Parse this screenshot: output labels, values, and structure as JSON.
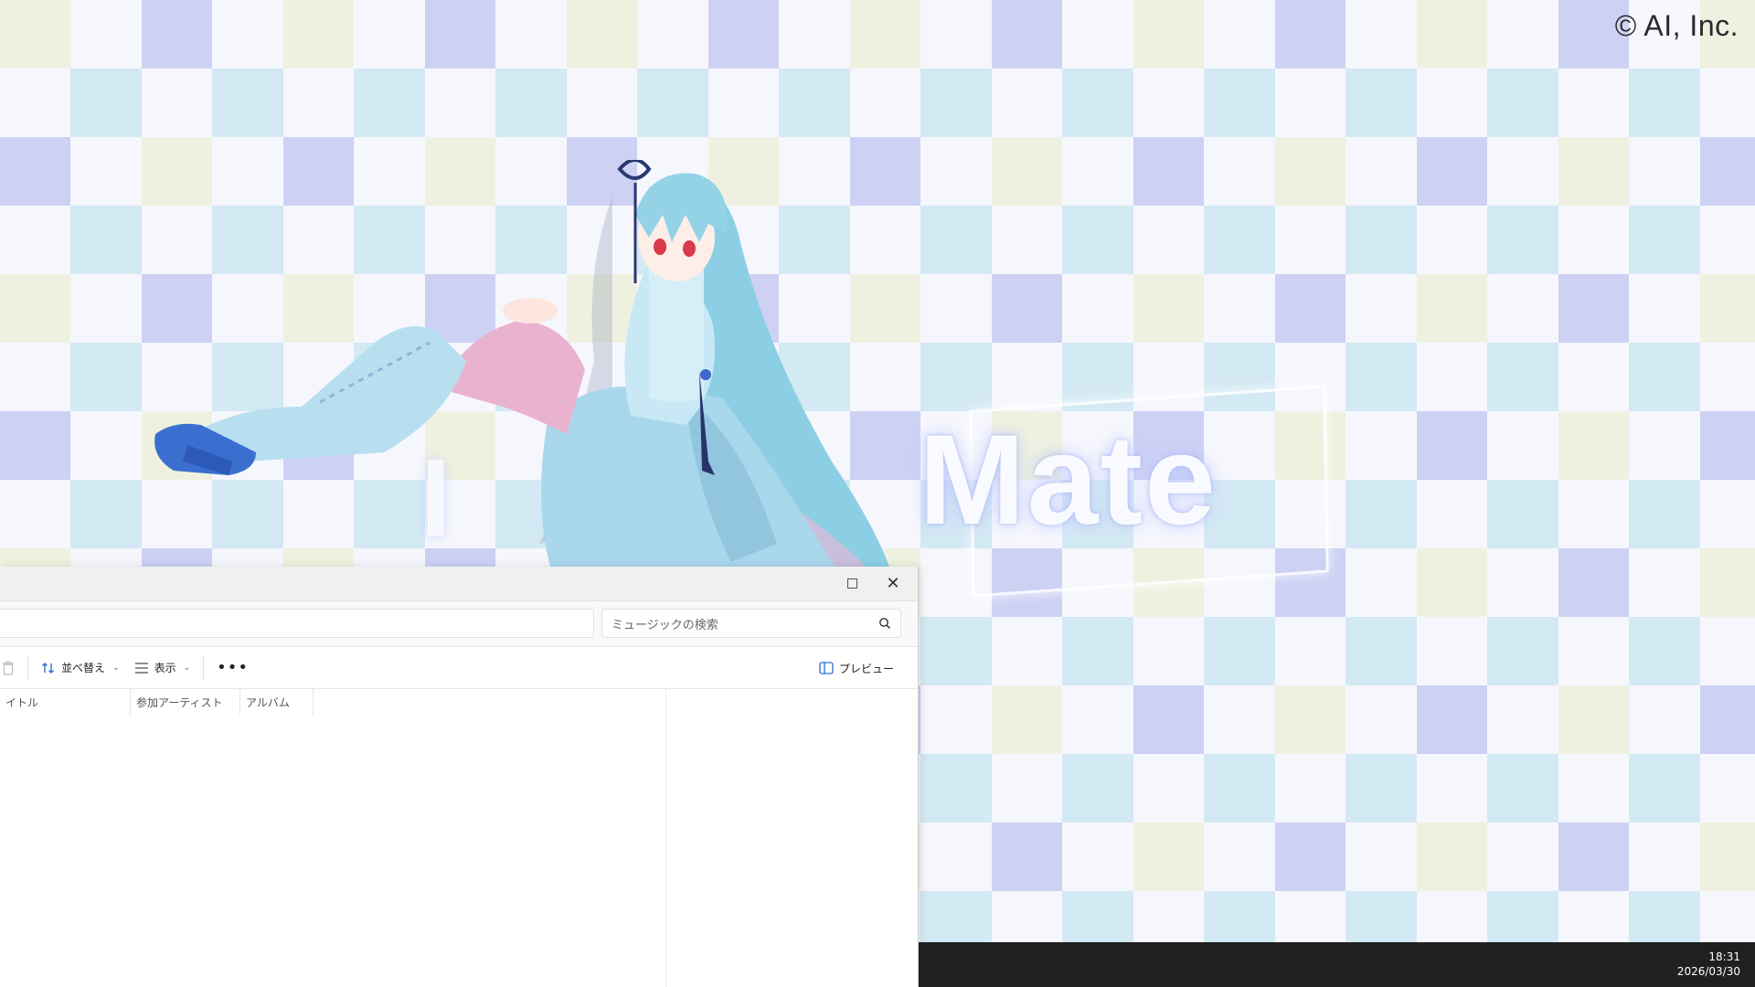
{
  "wallpaper": {
    "copyright": "© AI, Inc.",
    "logo_main": "Mate",
    "logo_faint": "I",
    "colors": {
      "lavender": "#c9cdf3",
      "sky": "#cfe8f2",
      "cream": "#eef0dc",
      "white": "#f7f8fd"
    }
  },
  "window": {
    "controls": {
      "maximize_icon": "maximize-icon",
      "close_icon": "close-icon",
      "close_glyph": "✕"
    },
    "search": {
      "placeholder": "ミュージックの検索",
      "icon": "search-icon"
    },
    "toolbar": {
      "sort_label": "並べ替え",
      "view_label": "表示",
      "more_label": "•••",
      "preview_label": "プレビュー"
    },
    "columns": [
      {
        "label": "イトル"
      },
      {
        "label": "参加アーティスト"
      },
      {
        "label": "アルバム"
      }
    ]
  },
  "taskbar": {
    "time": "18:31",
    "date": "2026/03/30"
  }
}
